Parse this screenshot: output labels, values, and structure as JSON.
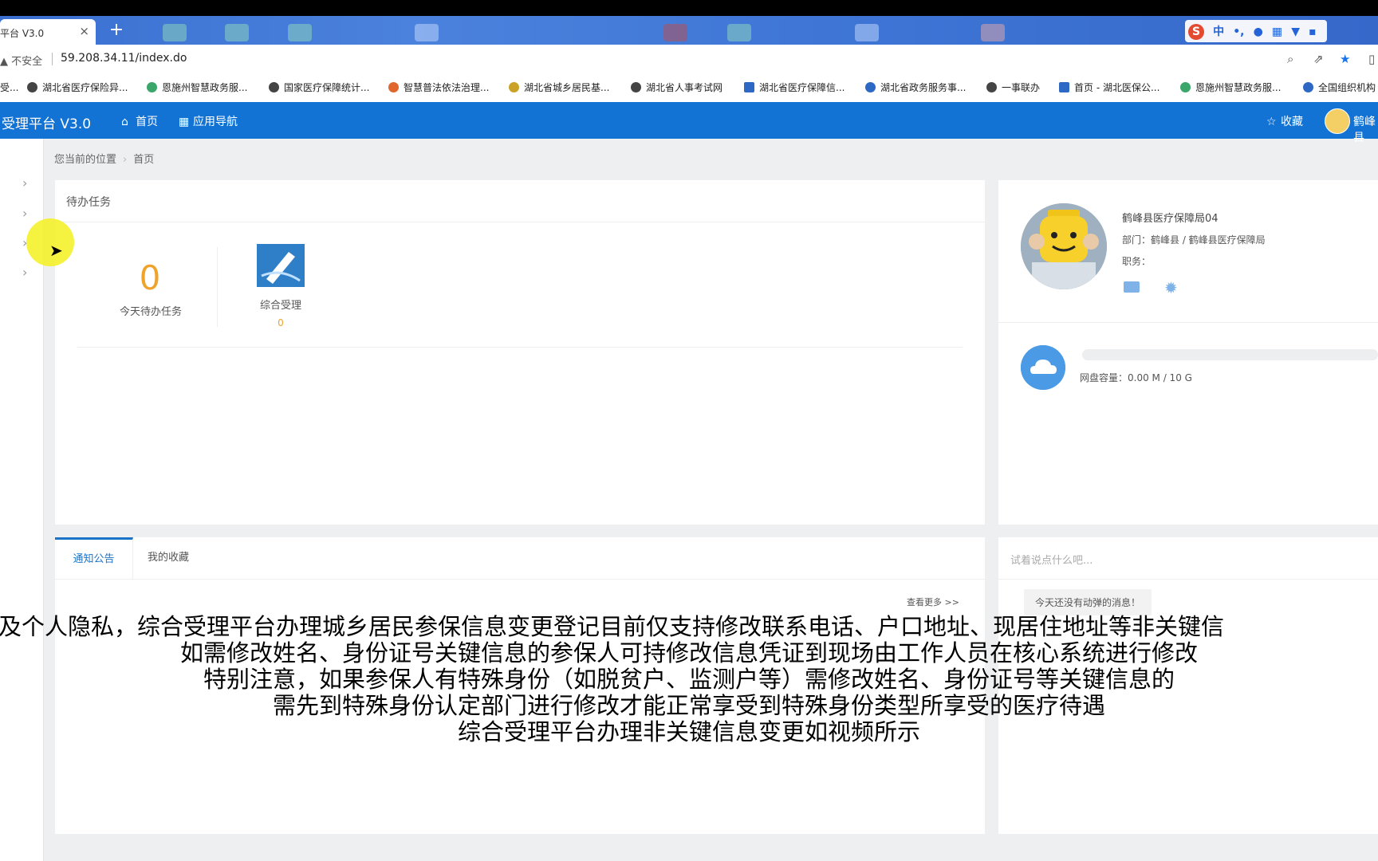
{
  "browser": {
    "tab_title": "平台 V3.0",
    "tab_close": "×",
    "new_tab": "+",
    "security_label": "不安全",
    "url": "59.208.34.11/index.do",
    "ime": {
      "label": "中",
      "extra": "•,"
    }
  },
  "bookmarks": [
    {
      "label": "湖北省医疗保险异...",
      "color": "#444444"
    },
    {
      "label": "恩施州智慧政务服...",
      "color": "#3aa66a"
    },
    {
      "label": "国家医疗保障统计...",
      "color": "#444444"
    },
    {
      "label": "智慧普法依法治理...",
      "color": "#e0662e"
    },
    {
      "label": "湖北省城乡居民基...",
      "color": "#c9a227"
    },
    {
      "label": "湖北省人事考试网",
      "color": "#444444"
    },
    {
      "label": "湖北省医疗保障信...",
      "color": "#2d68c4"
    },
    {
      "label": "湖北省政务服务事...",
      "color": "#2d68c4"
    },
    {
      "label": "一事联办",
      "color": "#444444"
    },
    {
      "label": "首页 - 湖北医保公...",
      "color": "#2d68c4"
    },
    {
      "label": "恩施州智慧政务服...",
      "color": "#3aa66a"
    },
    {
      "label": "全国组织机构",
      "color": "#2d68c4"
    }
  ],
  "bookmark_prefix": "受...",
  "app": {
    "title": "受理平台 V3.0",
    "nav_home": "首页",
    "nav_apps": "应用导航",
    "favorites": "收藏",
    "user_short": "鹤峰县"
  },
  "breadcrumb": {
    "label": "您当前的位置",
    "current": "首页"
  },
  "todo": {
    "header": "待办任务",
    "count": "0",
    "count_label": "今天待办任务",
    "app_label": "综合受理",
    "app_count": "0"
  },
  "profile": {
    "name": "鹤峰县医疗保障局04",
    "dept": "部门：鹤峰县 / 鹤峰县医疗保障局",
    "role": "职务："
  },
  "storage": {
    "label": "网盘容量：0.00 M / 10 G",
    "used_fraction": 0.0
  },
  "notice": {
    "tab_active": "通知公告",
    "tab_other": "我的收藏",
    "more": "查看更多 >>"
  },
  "feed": {
    "placeholder": "试着说点什么吧...",
    "empty": "今天还没有动弹的消息！"
  },
  "subtitles": [
    "及个人隐私，综合受理平台办理城乡居民参保信息变更登记目前仅支持修改联系电话、户口地址、现居住地址等非关键信",
    "如需修改姓名、身份证号关键信息的参保人可持修改信息凭证到现场由工作人员在核心系统进行修改",
    "特别注意，如果参保人有特殊身份（如脱贫户、监测户等）需修改姓名、身份证号等关键信息的",
    "需先到特殊身份认定部门进行修改才能正常享受到特殊身份类型所享受的医疗待遇",
    "综合受理平台办理非关键信息变更如视频所示"
  ],
  "icons": {
    "home": "home-icon",
    "apps": "grid-icon",
    "star": "star-icon",
    "mail": "mail-icon",
    "gear": "gear-icon",
    "cloud": "cloud-icon"
  }
}
